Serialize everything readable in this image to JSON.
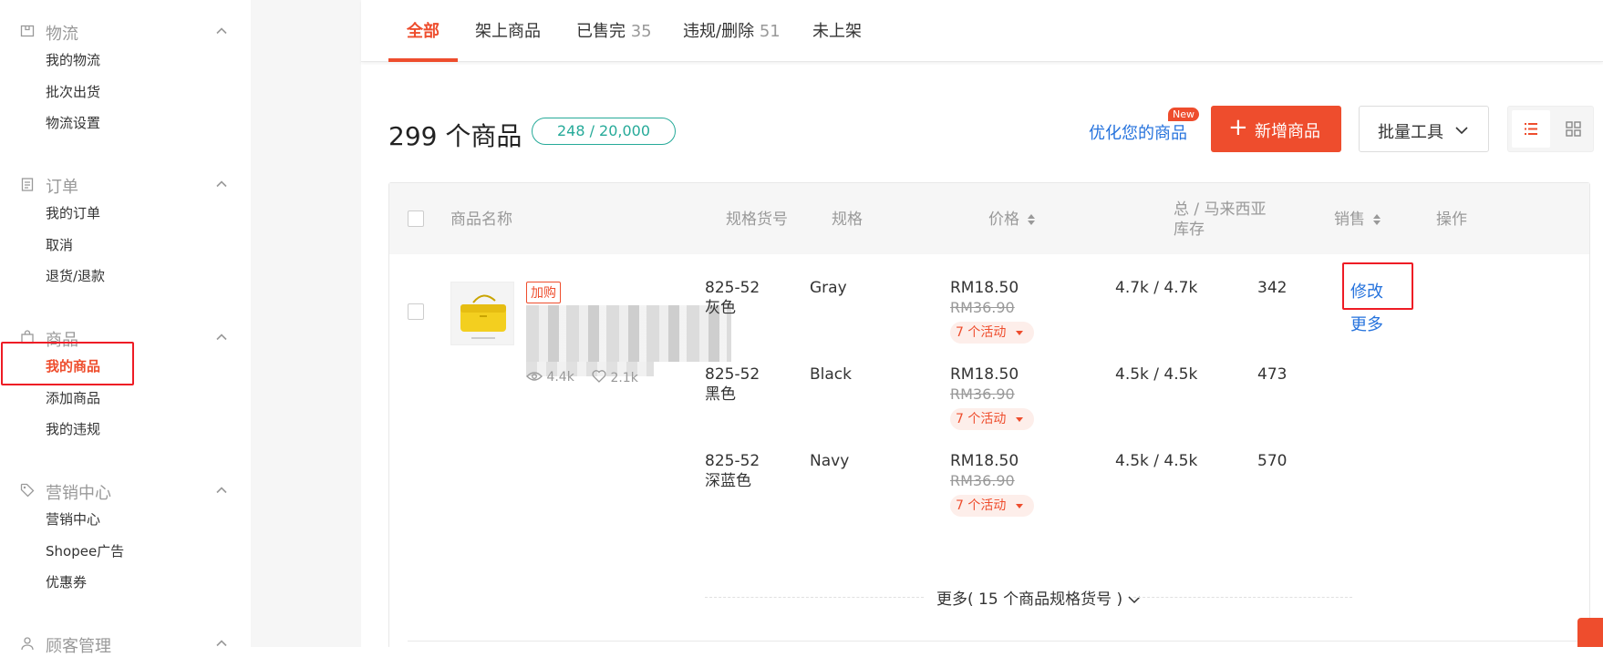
{
  "sidebar": {
    "groups": [
      {
        "title": "物流",
        "icon": "box-icon",
        "items": [
          "我的物流",
          "批次出货",
          "物流设置"
        ]
      },
      {
        "title": "订单",
        "icon": "clipboard-icon",
        "items": [
          "我的订单",
          "取消",
          "退货/退款"
        ]
      },
      {
        "title": "商品",
        "icon": "bag-icon",
        "items": [
          "我的商品",
          "添加商品",
          "我的违规"
        ]
      },
      {
        "title": "营销中心",
        "icon": "tag-icon",
        "items": [
          "营销中心",
          "Shopee广告",
          "优惠券"
        ]
      },
      {
        "title": "顾客管理",
        "icon": "user-icon",
        "items": []
      }
    ]
  },
  "tabs": [
    {
      "label": "全部",
      "count": ""
    },
    {
      "label": "架上商品",
      "count": ""
    },
    {
      "label": "已售完",
      "count": "35"
    },
    {
      "label": "违规/删除",
      "count": "51"
    },
    {
      "label": "未上架",
      "count": ""
    }
  ],
  "header": {
    "title": "299 个商品",
    "quota": "248 / 20,000",
    "optimize_link": "优化您的商品",
    "new_badge": "New",
    "add_button": "新增商品",
    "bulk_button": "批量工具"
  },
  "table": {
    "columns": {
      "name": "商品名称",
      "sku": "规格货号",
      "variation": "规格",
      "price": "价格",
      "stock": "总 / 马来西亚 库存",
      "sales": "销售",
      "actions": "操作"
    },
    "product": {
      "tag": "加购",
      "views": "4.4k",
      "likes": "2.1k",
      "edit_label": "修改",
      "more_label": "更多"
    },
    "rows": [
      {
        "sku_code": "825-52",
        "sku_color": "灰色",
        "variation": "Gray",
        "price": "RM18.50",
        "original_price": "RM36.90",
        "promo": "7 个活动",
        "stock": "4.7k / 4.7k",
        "sales": "342"
      },
      {
        "sku_code": "825-52",
        "sku_color": "黑色",
        "variation": "Black",
        "price": "RM18.50",
        "original_price": "RM36.90",
        "promo": "7 个活动",
        "stock": "4.5k / 4.5k",
        "sales": "473"
      },
      {
        "sku_code": "825-52",
        "sku_color": "深蓝色",
        "variation": "Navy",
        "price": "RM18.50",
        "original_price": "RM36.90",
        "promo": "7 个活动",
        "stock": "4.5k / 4.5k",
        "sales": "570"
      }
    ],
    "more_variations": "更多( 15 个商品规格货号 )"
  }
}
